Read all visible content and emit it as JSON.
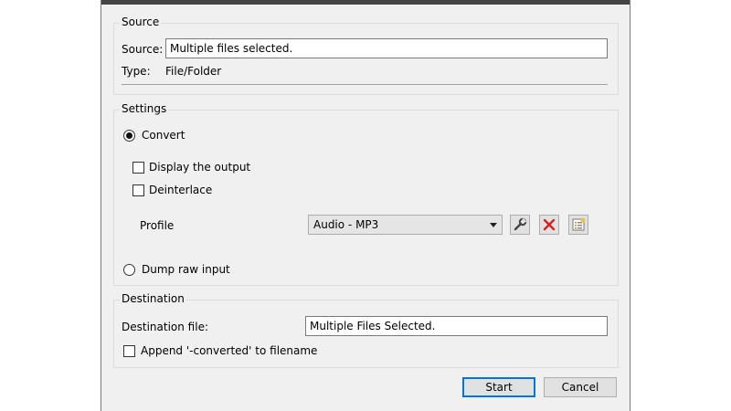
{
  "source_group": {
    "title": "Source",
    "source_label": "Source:",
    "source_value": "Multiple files selected.",
    "type_label": "Type:",
    "type_value": "File/Folder"
  },
  "settings_group": {
    "title": "Settings",
    "convert_label": "Convert",
    "convert_selected": true,
    "display_output_label": "Display the output",
    "display_output_checked": false,
    "deinterlace_label": "Deinterlace",
    "deinterlace_checked": false,
    "profile_label": "Profile",
    "profile_value": "Audio - MP3",
    "dump_raw_label": "Dump raw input",
    "dump_raw_selected": false
  },
  "destination_group": {
    "title": "Destination",
    "dest_file_label": "Destination file:",
    "dest_file_value": "Multiple Files Selected.",
    "append_label": "Append '-converted' to filename",
    "append_checked": false
  },
  "buttons": {
    "start_label": "Start",
    "cancel_label": "Cancel"
  },
  "colors": {
    "dialog_bg": "#f0f0f0",
    "delete_icon": "#d42020",
    "default_button_border": "#0078d7"
  }
}
